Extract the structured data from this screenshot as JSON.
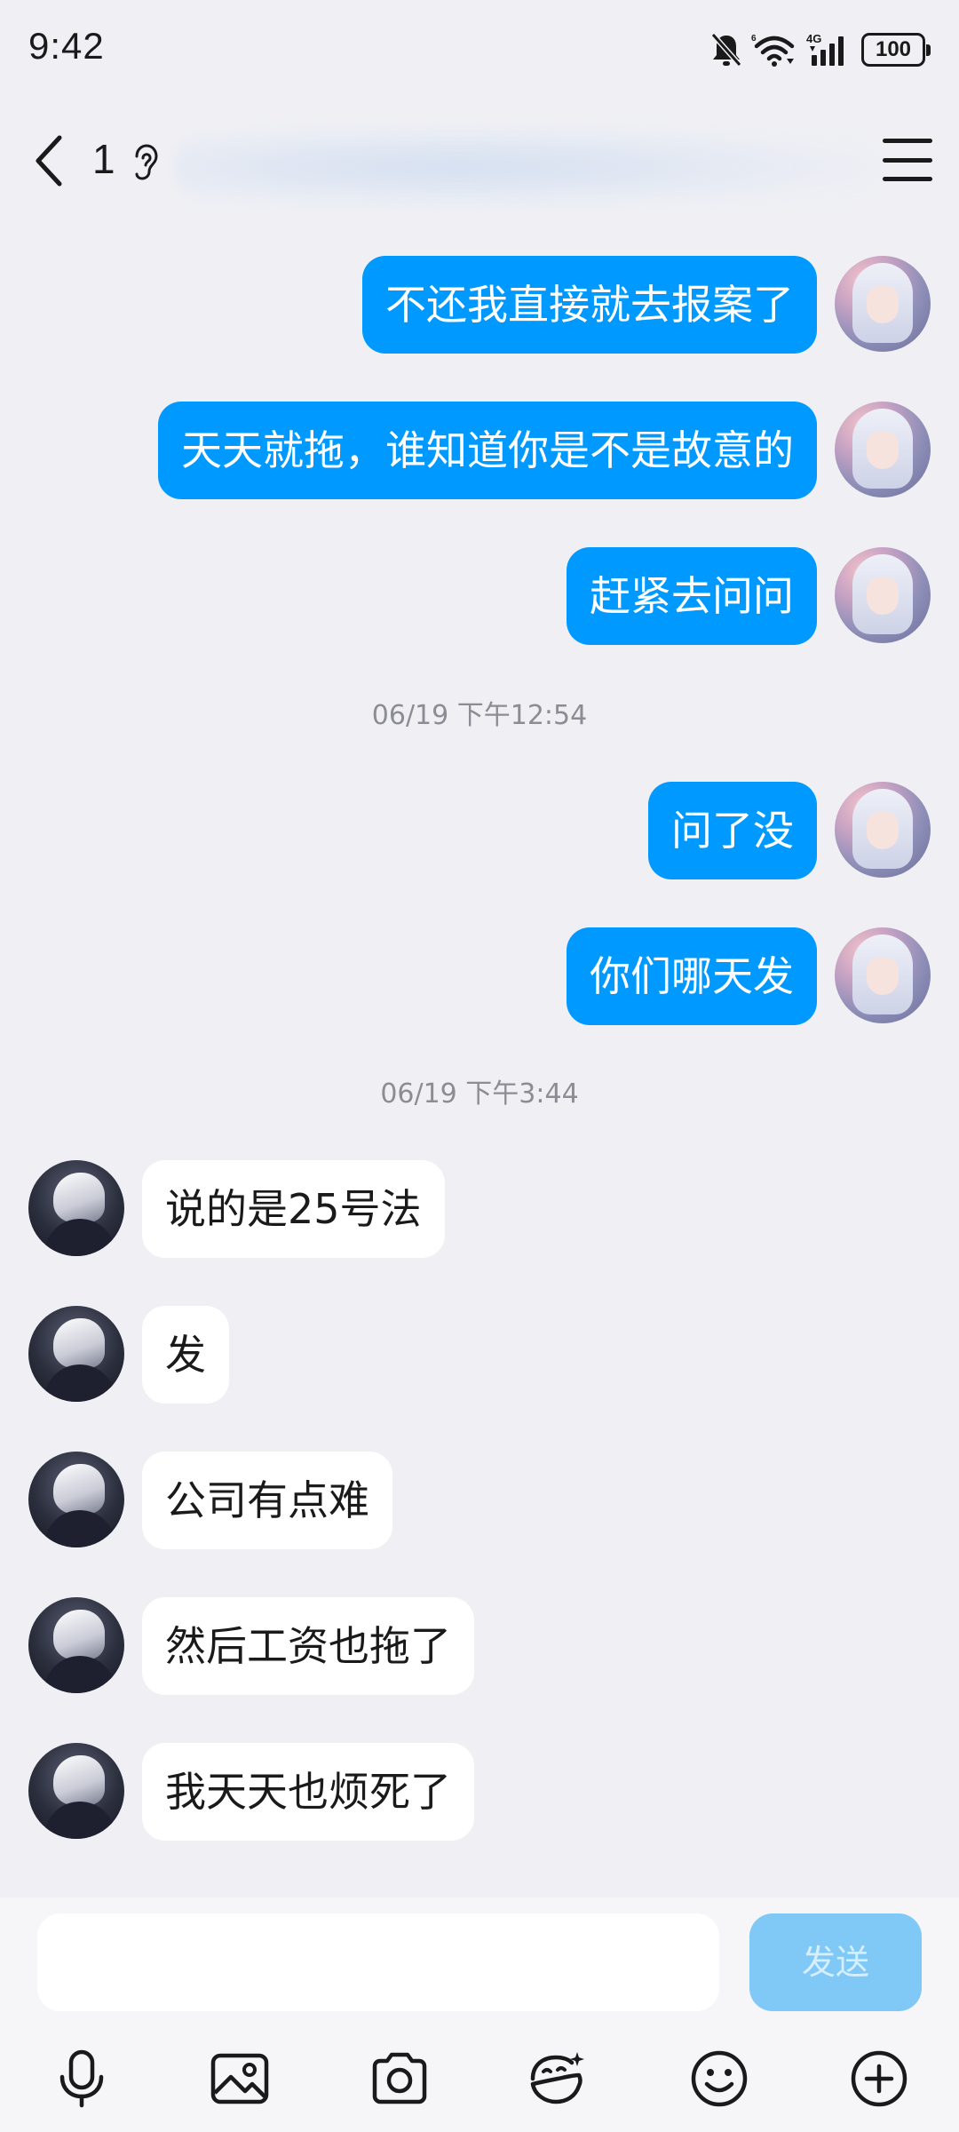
{
  "status_bar": {
    "time": "9:42",
    "battery": "100",
    "network": "4G",
    "icons": [
      "bell-off-icon",
      "wifi-icon",
      "signal-icon",
      "battery-icon"
    ]
  },
  "header": {
    "unread_count": "1",
    "icons": [
      "back-arrow-icon",
      "ear-icon",
      "menu-icon"
    ]
  },
  "messages": [
    {
      "type": "message",
      "side": "out",
      "text": "不还我直接就去报案了"
    },
    {
      "type": "message",
      "side": "out",
      "text": "天天就拖，谁知道你是不是故意的"
    },
    {
      "type": "message",
      "side": "out",
      "text": "赶紧去问问"
    },
    {
      "type": "timestamp",
      "text": "06/19 下午12:54"
    },
    {
      "type": "message",
      "side": "out",
      "text": "问了没"
    },
    {
      "type": "message",
      "side": "out",
      "text": "你们哪天发"
    },
    {
      "type": "timestamp",
      "text": "06/19 下午3:44"
    },
    {
      "type": "message",
      "side": "in",
      "text": "说的是25号法"
    },
    {
      "type": "message",
      "side": "in",
      "text": "发"
    },
    {
      "type": "message",
      "side": "in",
      "text": "公司有点难"
    },
    {
      "type": "message",
      "side": "in",
      "text": "然后工资也拖了"
    },
    {
      "type": "message",
      "side": "in",
      "text": "我天天也烦死了"
    }
  ],
  "input": {
    "value": "",
    "placeholder": "",
    "send_label": "发送"
  },
  "toolbar": {
    "items": [
      "microphone-icon",
      "image-icon",
      "camera-icon",
      "sticker-icon",
      "emoji-icon",
      "plus-icon"
    ]
  },
  "colors": {
    "outgoing_bubble": "#0099ff",
    "incoming_bubble": "#ffffff",
    "background": "#f0f0f4",
    "send_button": "#80c8f6"
  }
}
